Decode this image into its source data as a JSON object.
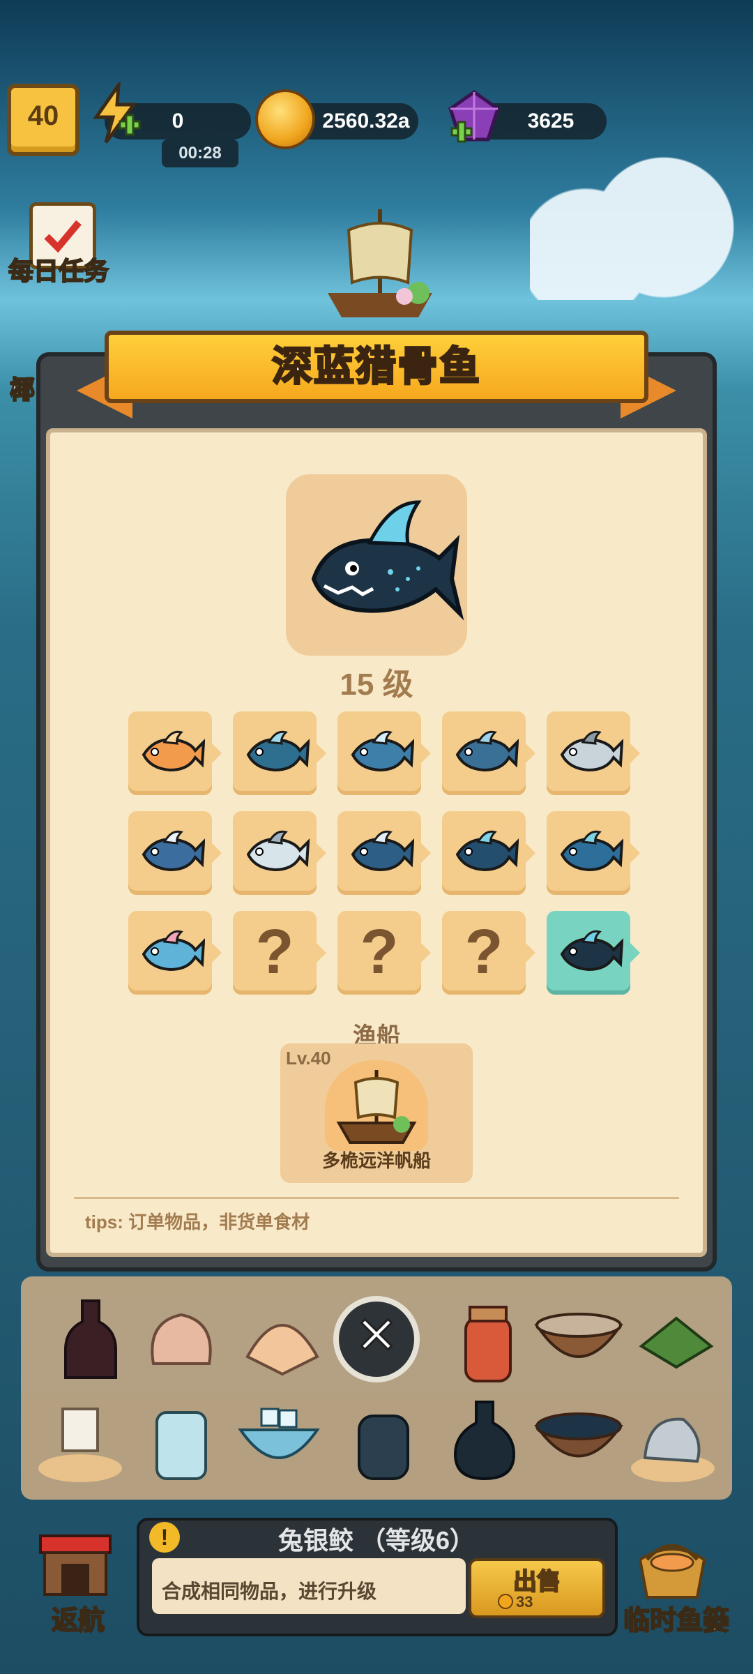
{
  "hud": {
    "player_level": "40",
    "energy": "0",
    "energy_timer": "00:28",
    "coins": "2560.32a",
    "gems": "3625",
    "daily_tasks_label": "每日任务",
    "side_label_partial": "椰"
  },
  "modal": {
    "title": "深蓝猎骨鱼",
    "level_text": "15 级",
    "evolution_grid": [
      {
        "kind": "fish",
        "color": "#f39b4d",
        "accent": "#ffd79a"
      },
      {
        "kind": "fish",
        "color": "#2e6f8f",
        "accent": "#9fd9ec"
      },
      {
        "kind": "fish",
        "color": "#3d7fa8",
        "accent": "#d6eef7"
      },
      {
        "kind": "fish",
        "color": "#3a6f96",
        "accent": "#9fd4e8"
      },
      {
        "kind": "fish",
        "color": "#c8d3da",
        "accent": "#8d9aa4"
      },
      {
        "kind": "fish",
        "color": "#3b6e9e",
        "accent": "#e8f2f7"
      },
      {
        "kind": "fish",
        "color": "#d7e4ea",
        "accent": "#9fb3bf"
      },
      {
        "kind": "fish",
        "color": "#2d5f86",
        "accent": "#e3eef4"
      },
      {
        "kind": "fish",
        "color": "#234e6e",
        "accent": "#7fd3e6"
      },
      {
        "kind": "fish",
        "color": "#2d6f9a",
        "accent": "#7fd3e6"
      },
      {
        "kind": "fish",
        "color": "#5fb3d9",
        "accent": "#f2a5b8"
      },
      {
        "kind": "unknown",
        "label": "?"
      },
      {
        "kind": "unknown",
        "label": "?"
      },
      {
        "kind": "unknown",
        "label": "?"
      },
      {
        "kind": "fish",
        "color": "#1d3447",
        "accent": "#6fd0ea",
        "current": true
      }
    ],
    "boat_section_label": "渔船",
    "boat_level": "Lv.40",
    "boat_name": "多桅远洋帆船",
    "tips": "tips: 订单物品，非货单食材",
    "close_glyph": "✕"
  },
  "bottom": {
    "info_glyph": "!",
    "item_name": "兔银鲛 （等级6）",
    "description": "合成相同物品，进行升级",
    "sell_label": "出售",
    "sell_price": "33",
    "return_label": "返航",
    "basket_label": "临时鱼篓"
  },
  "colors": {
    "accent": "#f6a81e",
    "panel": "#f8e9c9",
    "frame": "#3f4549"
  }
}
